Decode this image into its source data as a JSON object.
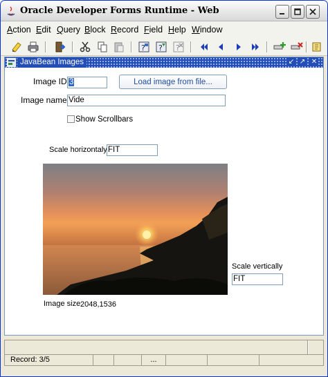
{
  "window": {
    "title": "Oracle Developer Forms Runtime - Web"
  },
  "menu": [
    {
      "label": "Action",
      "u": "A",
      "rest": "ction"
    },
    {
      "label": "Edit",
      "u": "E",
      "rest": "dit"
    },
    {
      "label": "Query",
      "u": "Q",
      "rest": "uery"
    },
    {
      "label": "Block",
      "u": "B",
      "rest": "lock"
    },
    {
      "label": "Record",
      "u": "R",
      "rest": "ecord"
    },
    {
      "label": "Field",
      "u": "F",
      "rest": "ield"
    },
    {
      "label": "Help",
      "u": "H",
      "rest": "elp"
    },
    {
      "label": "Window",
      "u": "W",
      "rest": "indow"
    }
  ],
  "toolbar": {
    "icons": [
      "save-icon",
      "print-icon",
      "exit-icon",
      "cut-icon",
      "copy-icon",
      "paste-icon",
      "enter-query-icon",
      "execute-query-icon",
      "cancel-query-icon",
      "first-record-icon",
      "previous-record-icon",
      "next-record-icon",
      "last-record-icon",
      "insert-record-icon",
      "delete-record-icon",
      "help-icon"
    ]
  },
  "subwindow": {
    "title": "JavaBean Images"
  },
  "form": {
    "image_id_label": "Image ID",
    "image_id_value": "3",
    "load_button": "Load image from file...",
    "image_name_label": "Image name",
    "image_name_value": "Vide",
    "show_scrollbars_label": "Show Scrollbars",
    "show_scrollbars_checked": false,
    "scale_h_label": "Scale horizontaly",
    "scale_h_value": "FIT",
    "scale_v_label": "Scale vertically",
    "scale_v_value": "FIT",
    "image_size_label": "Image size",
    "image_size_value": "2048,1536"
  },
  "status": {
    "record": "Record: 3/5",
    "ellipsis": "..."
  },
  "colors": {
    "accent": "#224eb5",
    "selection": "#316ac5"
  }
}
